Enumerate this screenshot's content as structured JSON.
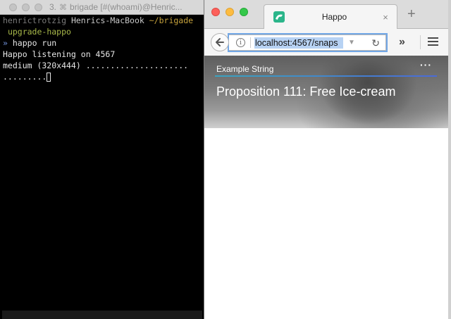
{
  "terminal": {
    "title_prefix": "3.",
    "title": "brigade [#(whoami)@Henric...",
    "lines": {
      "user": "henrictrotzig",
      "host": "Henrics-MacBook",
      "path": "~/brigade",
      "branch": "upgrade-happo",
      "prompt_symbol": "»",
      "command": "happo run",
      "output1": "Happo listening on 4567",
      "output2": "medium (320x444) .....................",
      "output3": "........."
    }
  },
  "browser": {
    "tab_title": "Happo",
    "tab_close": "×",
    "new_tab": "+",
    "url": "localhost:4567/snaps",
    "overflow": "»",
    "page": {
      "label": "Example String",
      "more": "···",
      "title": "Proposition 111: Free Ice-cream"
    }
  },
  "colors": {
    "accent_line_start": "#3aa3c0",
    "accent_line_end": "#4a6bd8",
    "url_focus": "#72a7e6"
  }
}
